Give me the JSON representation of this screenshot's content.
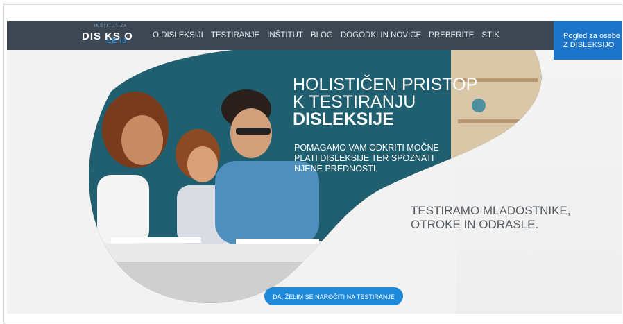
{
  "header": {
    "logo_top": "INŠTITUT ZA",
    "logo_main": "DIS  KS  O",
    "logo_accent": "LE  IJ",
    "nav_items": [
      "O DISLEKSIJI",
      "TESTIRANJE",
      "INŠTITUT",
      "BLOG",
      "DOGODKI IN NOVICE",
      "PREBERITE",
      "STIK"
    ],
    "accessibility_line1": "Pogled za osebe",
    "accessibility_line2": "Z DISLEKSIJO"
  },
  "hero": {
    "heading_line1": "HOLISTIČEN PRISTOP",
    "heading_line2": "K TESTIRANJU",
    "heading_line3": "DISLEKSIJE",
    "subtext": "POMAGAMO VAM ODKRITI MOČNE PLATI DISLEKSIJE TER SPOZNATI NJENE PREDNOSTI.",
    "tagline": "TESTIRAMO MLADOSTNIKE, OTROKE IN ODRASLE.",
    "cta": "DA, ŽELIM SE NAROČITI NA TESTIRANJE"
  },
  "colors": {
    "nav_bg": "#3c4753",
    "accent_blue": "#1e88d9",
    "teal_wall": "#1f5f6f",
    "page_bg": "#f2f2f2"
  }
}
